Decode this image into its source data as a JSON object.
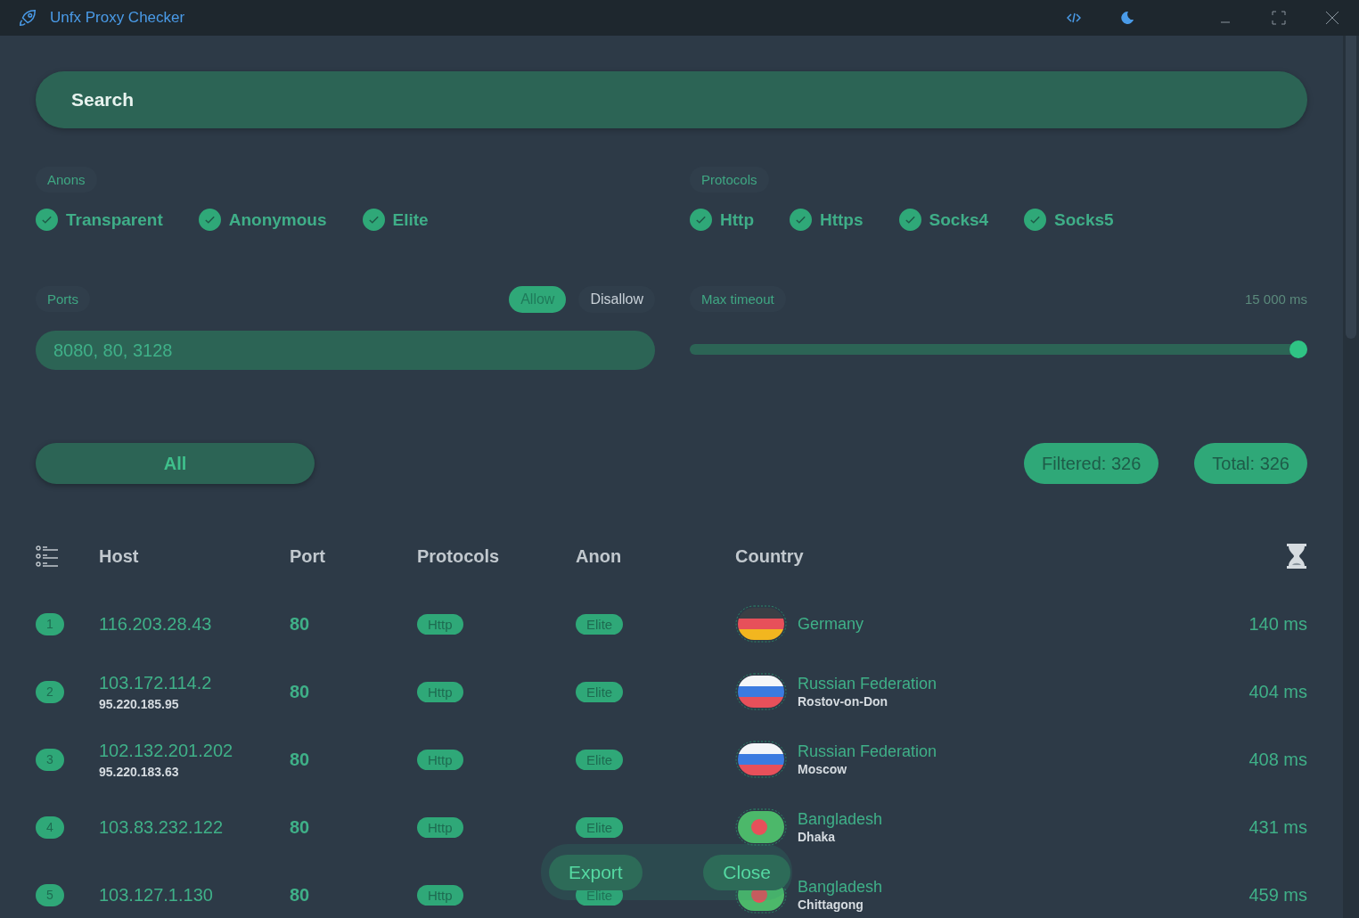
{
  "window": {
    "title": "Unfx Proxy Checker"
  },
  "search": {
    "placeholder": "Search"
  },
  "anons": {
    "label": "Anons",
    "options": [
      {
        "label": "Transparent",
        "checked": true
      },
      {
        "label": "Anonymous",
        "checked": true
      },
      {
        "label": "Elite",
        "checked": true
      }
    ]
  },
  "protocols": {
    "label": "Protocols",
    "options": [
      {
        "label": "Http",
        "checked": true
      },
      {
        "label": "Https",
        "checked": true
      },
      {
        "label": "Socks4",
        "checked": true
      },
      {
        "label": "Socks5",
        "checked": true
      }
    ]
  },
  "ports": {
    "label": "Ports",
    "modes": [
      {
        "label": "Allow",
        "selected": true
      },
      {
        "label": "Disallow",
        "selected": false
      }
    ],
    "value": "8080, 80, 3128"
  },
  "timeout": {
    "label": "Max timeout",
    "reading": "15 000 ms",
    "level": 1
  },
  "filter_button": "All",
  "counters": [
    "Filtered: 326",
    "Total: 326"
  ],
  "table": {
    "columns": [
      "Host",
      "Port",
      "Protocols",
      "Anon",
      "Country"
    ],
    "rows": [
      {
        "index": "1",
        "host": "116.203.28.43",
        "port": "80",
        "protocol": "Http",
        "anon": "Elite",
        "kind": "de",
        "country": "Germany",
        "ping": "140 ms"
      },
      {
        "index": "2",
        "host": "103.172.114.2",
        "host_sub": "95.220.185.95",
        "port": "80",
        "protocol": "Http",
        "anon": "Elite",
        "kind": "ru",
        "country": "Russian Federation",
        "city": "Rostov-on-Don",
        "ping": "404 ms"
      },
      {
        "index": "3",
        "host": "102.132.201.202",
        "host_sub": "95.220.183.63",
        "port": "80",
        "protocol": "Http",
        "anon": "Elite",
        "kind": "ru",
        "country": "Russian Federation",
        "city": "Moscow",
        "ping": "408 ms"
      },
      {
        "index": "4",
        "host": "103.83.232.122",
        "port": "80",
        "protocol": "Http",
        "anon": "Elite",
        "kind": "bd",
        "country": "Bangladesh",
        "city": "Dhaka",
        "ping": "431 ms"
      },
      {
        "index": "5",
        "host": "103.127.1.130",
        "port": "80",
        "protocol": "Http",
        "anon": "Elite",
        "kind": "bd",
        "country": "Bangladesh",
        "city": "Chittagong",
        "ping": "459 ms"
      }
    ]
  },
  "actions": [
    "Export",
    "Close"
  ]
}
